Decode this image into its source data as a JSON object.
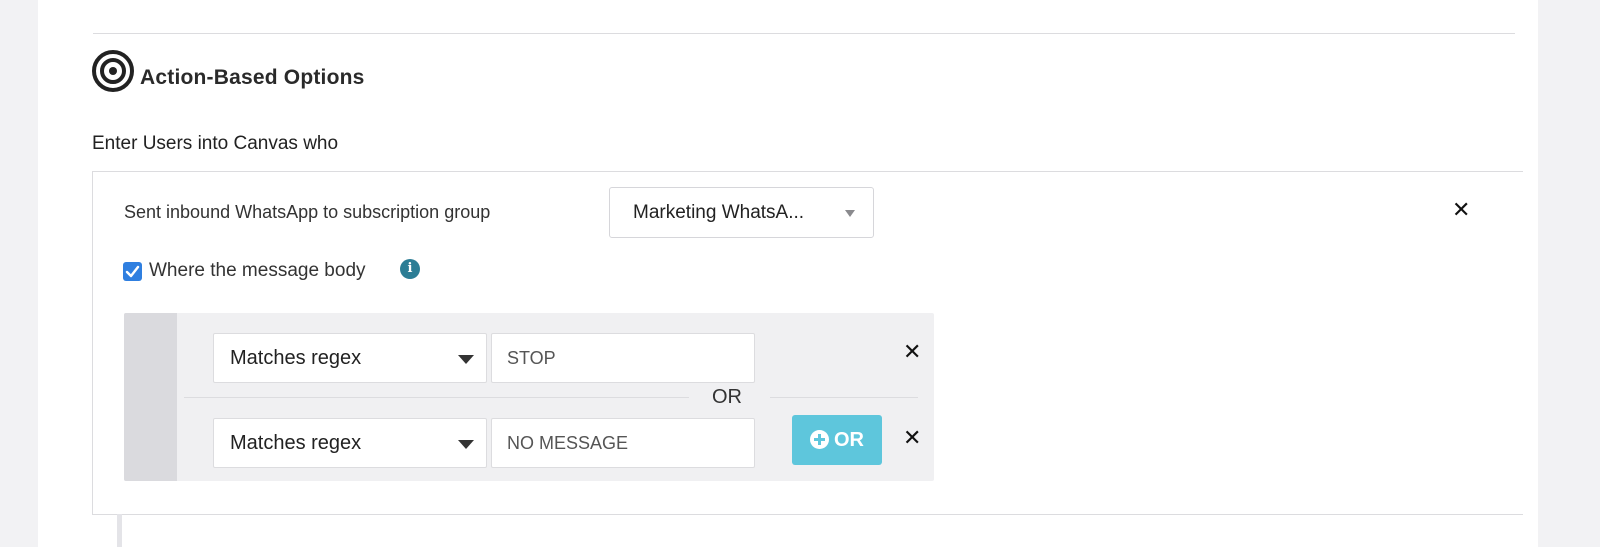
{
  "section": {
    "title": "Action-Based Options",
    "icon": "target-icon"
  },
  "entry": {
    "label": "Enter Users into Canvas who"
  },
  "trigger": {
    "event_label": "Sent inbound WhatsApp to subscription group",
    "group_value": "Marketing WhatsA...",
    "remove_icon": "close-icon"
  },
  "message_body": {
    "checkbox_label": "Where the message body",
    "checked": true,
    "info_icon": "info-icon"
  },
  "filters": {
    "or_separator": "OR",
    "add_or_label": "OR",
    "rows": [
      {
        "operator": "Matches regex",
        "value": "STOP"
      },
      {
        "operator": "Matches regex",
        "value": "NO MESSAGE"
      }
    ]
  },
  "colors": {
    "checkbox": "#2f7fe0",
    "info": "#2c7d95",
    "or_button": "#5ec6dc"
  }
}
